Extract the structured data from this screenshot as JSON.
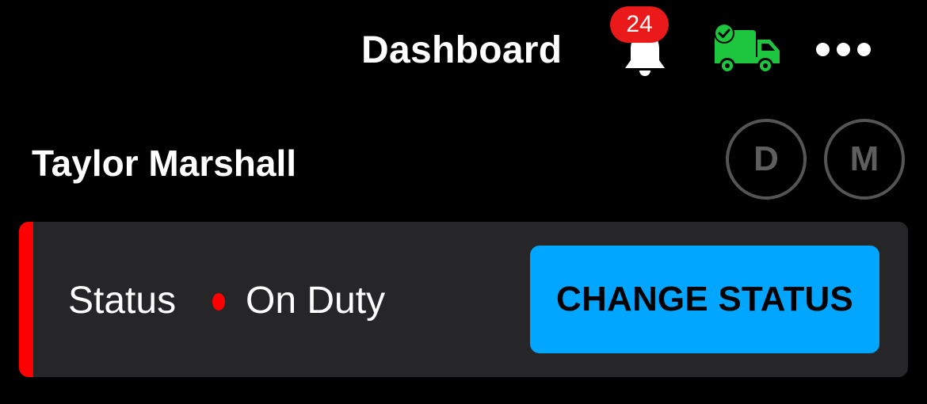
{
  "header": {
    "title": "Dashboard",
    "notifications": {
      "count": "24",
      "icon": "bell-icon",
      "badge_color": "#ea1a1a"
    },
    "vehicle_status": {
      "icon": "truck-check-icon",
      "color": "#1ec640"
    },
    "more_icon": "more-horizontal-icon"
  },
  "driver": {
    "name": "Taylor Marshall",
    "buttons": [
      {
        "label": "D"
      },
      {
        "label": "M"
      }
    ]
  },
  "status_card": {
    "label": "Status",
    "value": "On Duty",
    "indicator_color": "#ff0000",
    "button_label": "CHANGE STATUS",
    "button_color": "#00a6ff"
  }
}
